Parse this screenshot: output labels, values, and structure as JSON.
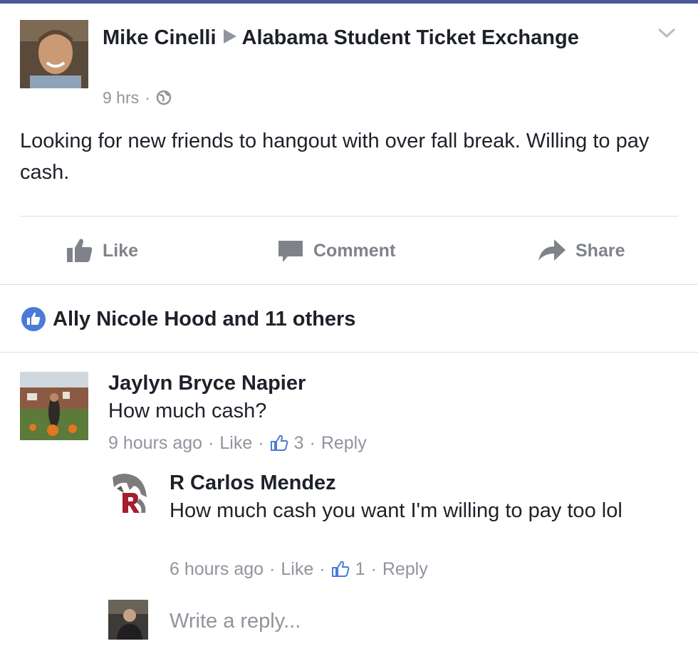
{
  "post": {
    "author": "Mike Cinelli",
    "group": "Alabama Student Ticket Exchange",
    "time": "9 hrs",
    "separator": "·",
    "text": "Looking for new friends to hangout with over fall break. Willing to pay cash."
  },
  "actions": {
    "like": "Like",
    "comment": "Comment",
    "share": "Share"
  },
  "likes_summary": "Ally Nicole Hood and 11 others",
  "comments": [
    {
      "name": "Jaylyn Bryce Napier",
      "text": "How much cash?",
      "time": "9 hours ago",
      "like": "Like",
      "count": "3",
      "reply": "Reply"
    },
    {
      "name": "R Carlos Mendez",
      "text": "How much cash you want I'm willing to pay too lol",
      "time": "6 hours ago",
      "like": "Like",
      "count": "1",
      "reply": "Reply"
    }
  ],
  "reply_box": {
    "placeholder": "Write a reply..."
  },
  "colors": {
    "accent": "#4b7bd6",
    "muted": "#90949c",
    "topbar": "#4a5897"
  },
  "icons": [
    "chevron-down-icon",
    "globe-icon",
    "like-icon",
    "comment-icon",
    "share-icon",
    "like-badge-icon",
    "thumb-mini-icon"
  ]
}
